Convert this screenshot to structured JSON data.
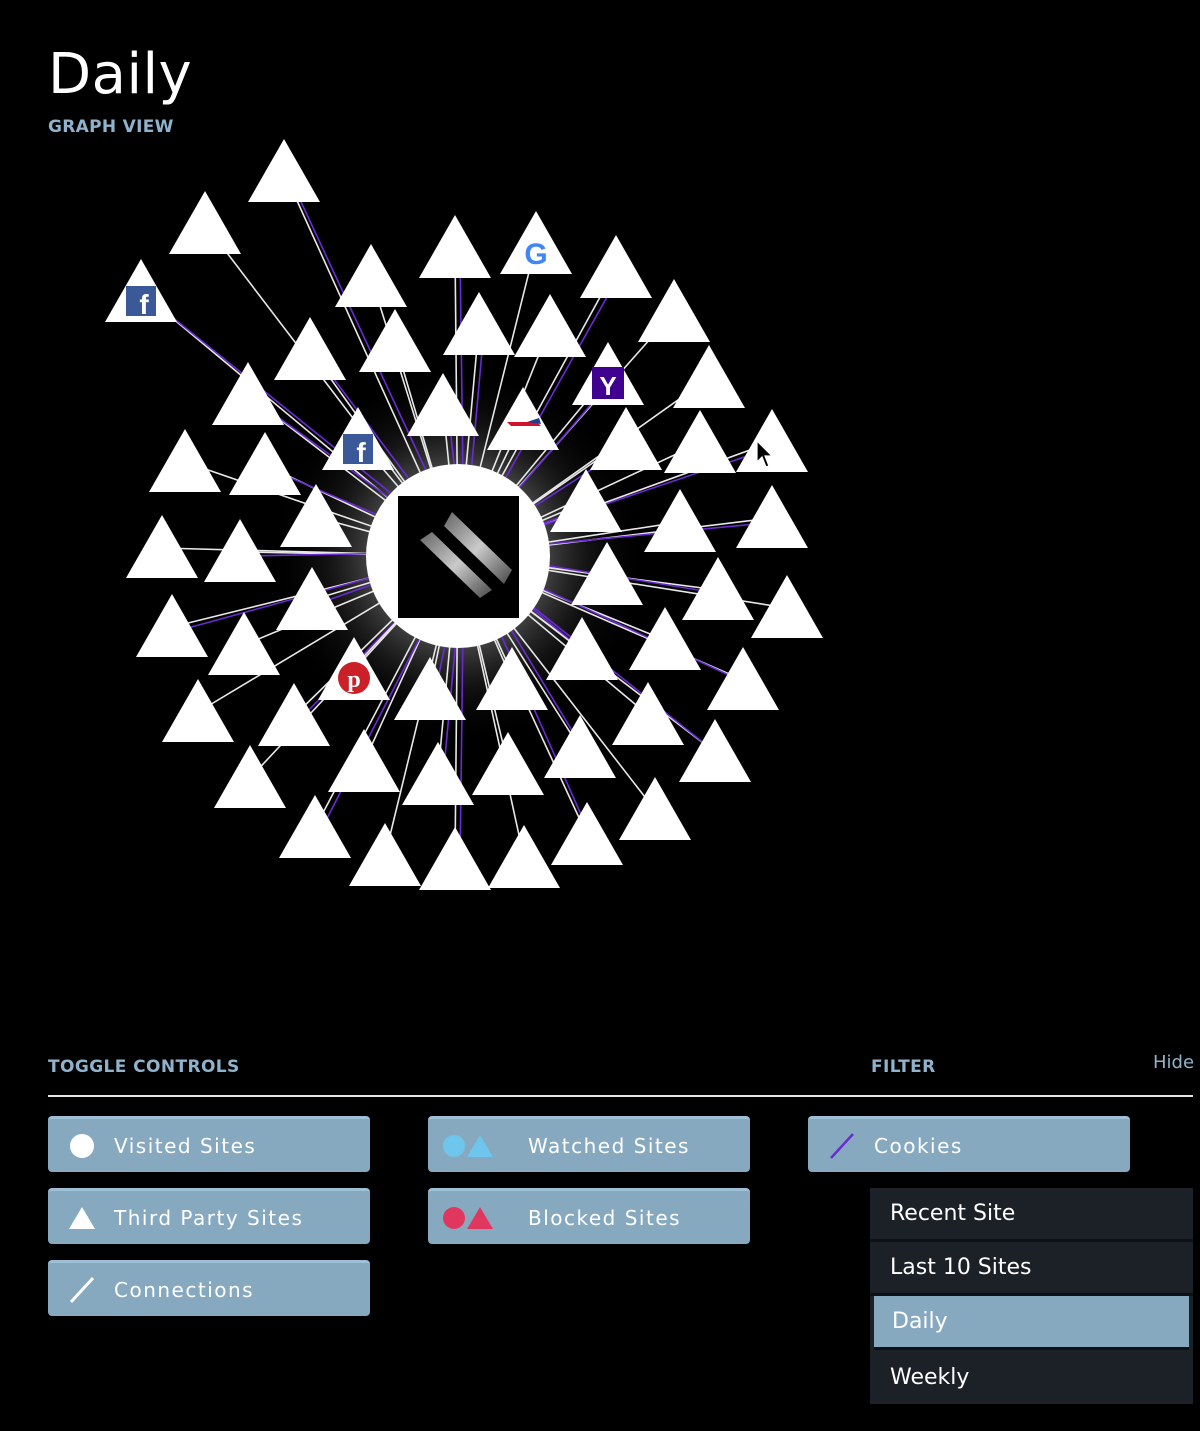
{
  "header": {
    "title": "Daily",
    "subtitle": "GRAPH VIEW"
  },
  "graph": {
    "center_node": "lightbeam-logo",
    "branded_nodes": [
      "facebook-icon",
      "google-icon",
      "yahoo-icon",
      "airline-logo-icon",
      "pinterest-icon"
    ]
  },
  "controls": {
    "toggle_label": "TOGGLE CONTROLS",
    "filter_label": "FILTER",
    "hide_label": "Hide",
    "buttons": {
      "visited": "Visited Sites",
      "watched": "Watched Sites",
      "cookies": "Cookies",
      "third_party": "Third Party Sites",
      "blocked": "Blocked Sites",
      "connections": "Connections"
    },
    "filter_options": [
      "Recent Site",
      "Last 10 Sites",
      "Daily",
      "Weekly"
    ],
    "filter_selected": "Daily"
  },
  "colors": {
    "accent": "#87a9bf",
    "label": "#8fb3cc",
    "watched": "#6ec6ec",
    "blocked": "#e0375f",
    "cookie_line": "#6a2bd1",
    "menu_bg": "#1c2127"
  }
}
